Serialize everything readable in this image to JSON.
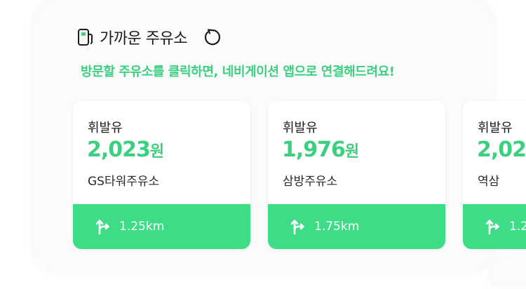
{
  "header": {
    "title": "가까운 주유소",
    "fuel_icon": "fuel-pump-icon",
    "refresh_icon": "refresh-icon"
  },
  "notice": "방문할 주유소를 클릭하면, 네비게이션 앱으로 연결해드려요!",
  "colors": {
    "accent": "#3ccf7f",
    "footer": "#3ddc87",
    "text": "#1b1b1b"
  },
  "stations": [
    {
      "fuel_type": "휘발유",
      "price": "2,023",
      "unit": "원",
      "name": "GS타워주유소",
      "distance": "1.25km"
    },
    {
      "fuel_type": "휘발유",
      "price": "1,976",
      "unit": "원",
      "name": "삼방주유소",
      "distance": "1.75km"
    },
    {
      "fuel_type": "휘발유",
      "price": "2,02",
      "unit": "",
      "name": "역삼",
      "distance": "1.2"
    }
  ]
}
